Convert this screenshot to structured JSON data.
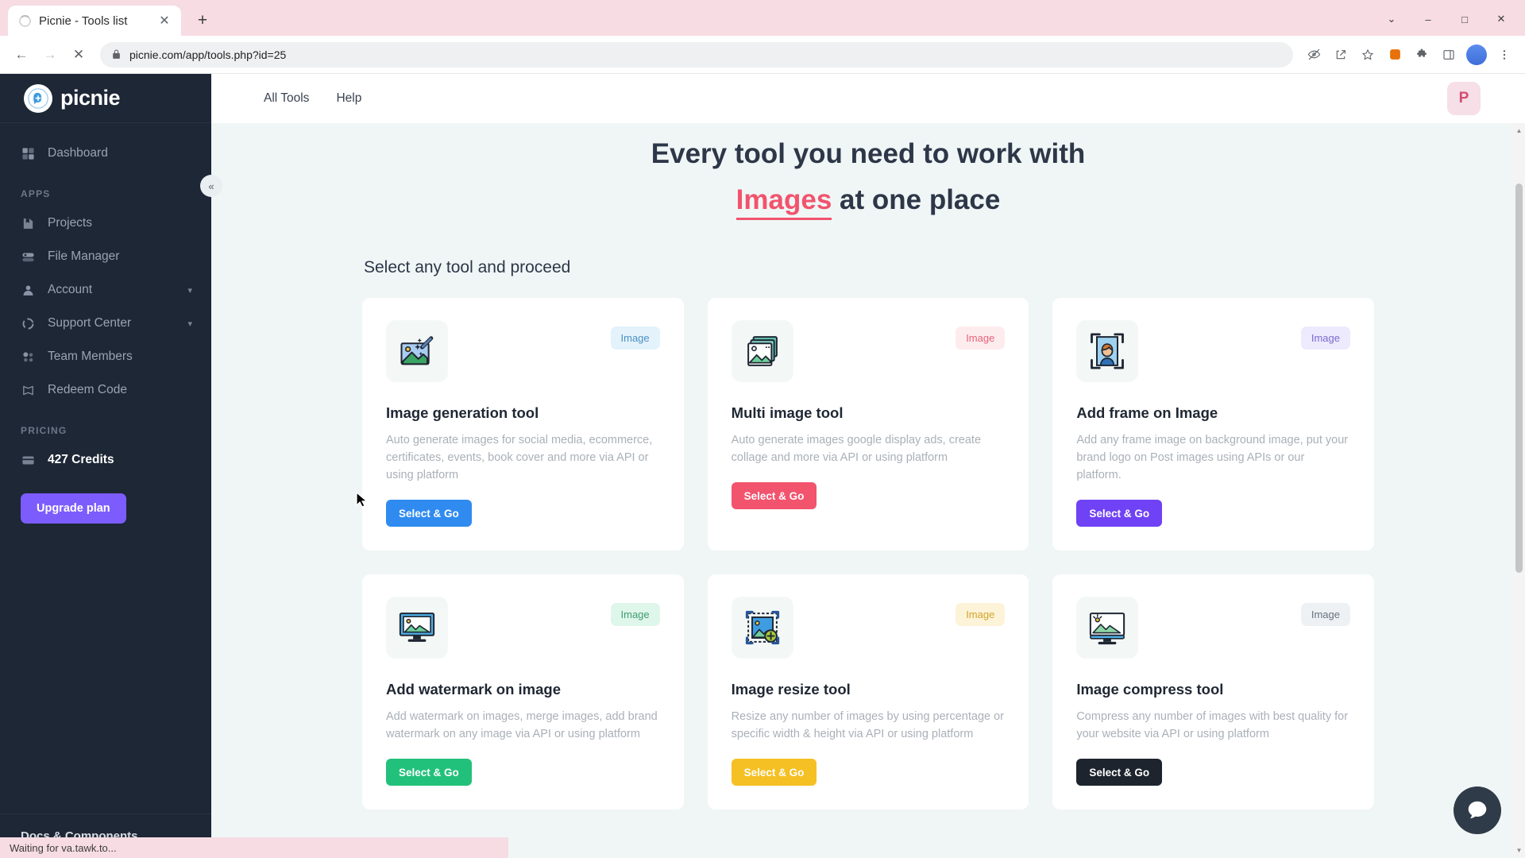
{
  "browser": {
    "tab": {
      "title": "Picnie - Tools list",
      "loading_icon": "spinner-icon",
      "close_icon": "close-icon"
    },
    "new_tab_label": "+",
    "window_controls": {
      "minimize": "–",
      "maximize": "□",
      "close": "✕",
      "list": "⌄"
    },
    "url": "picnie.com/app/tools.php?id=25",
    "nav": {
      "back": "←",
      "forward": "→",
      "stop": "✕"
    },
    "toolbar_icons": [
      "no-track-icon",
      "share-icon",
      "bookmark-star-icon",
      "extension-orange-icon",
      "puzzle-extension-icon",
      "sidepanel-icon",
      "profile-avatar",
      "menu-kebab-icon"
    ],
    "profile_initial": "",
    "status_text": "Waiting for va.tawk.to..."
  },
  "sidebar": {
    "brand": "picnie",
    "collapse_icon": "«",
    "items": [
      {
        "label": "Dashboard",
        "icon": "dashboard-grid-icon",
        "chevron": false
      },
      {
        "label": "Projects",
        "icon": "projects-box-icon",
        "chevron": false
      },
      {
        "label": "File Manager",
        "icon": "file-manager-icon",
        "chevron": false
      },
      {
        "label": "Account",
        "icon": "account-user-icon",
        "chevron": true
      },
      {
        "label": "Support Center",
        "icon": "support-life-ring-icon",
        "chevron": true
      },
      {
        "label": "Team Members",
        "icon": "team-members-icon",
        "chevron": false
      },
      {
        "label": "Redeem Code",
        "icon": "redeem-book-icon",
        "chevron": false
      }
    ],
    "section_apps": "APPS",
    "section_pricing": "PRICING",
    "credits": "427 Credits",
    "credits_icon": "credits-card-icon",
    "upgrade_label": "Upgrade plan",
    "footer_label": "Docs & Components"
  },
  "topbar": {
    "links": [
      {
        "label": "All Tools"
      },
      {
        "label": "Help"
      }
    ],
    "user_initial": "P"
  },
  "hero": {
    "line1": "Every tool you need to work with",
    "accent": "Images",
    "line2_tail": "at one place"
  },
  "main": {
    "section_title": "Select any tool and proceed",
    "cards": [
      {
        "title": "Image generation tool",
        "desc": "Auto generate images for social media, ecommerce, certificates, events, book cover and more via API or using platform",
        "badge": "Image",
        "badge_bg": "#e3f2fb",
        "badge_color": "#4b91c4",
        "btn_label": "Select & Go",
        "btn_bg": "#2f8bf0",
        "icon": "image-magic-wand-icon"
      },
      {
        "title": "Multi image tool",
        "desc": "Auto generate images google display ads, create collage and more via API or using platform",
        "badge": "Image",
        "badge_bg": "#fdecee",
        "badge_color": "#e8637a",
        "btn_label": "Select & Go",
        "btn_bg": "#f2536d",
        "icon": "multi-image-stack-icon"
      },
      {
        "title": "Add frame on Image",
        "desc": "Add any frame image on background image, put your brand logo on Post images using APIs or our platform.",
        "badge": "Image",
        "badge_bg": "#eeeafd",
        "badge_color": "#7a6bd0",
        "btn_label": "Select & Go",
        "btn_bg": "#7042f5",
        "icon": "frame-portrait-icon"
      },
      {
        "title": "Add watermark on image",
        "desc": "Add watermark on images, merge images, add brand watermark on any image via API or using platform",
        "badge": "Image",
        "badge_bg": "#dff6ea",
        "badge_color": "#3f9e70",
        "btn_label": "Select & Go",
        "btn_bg": "#22c17b",
        "icon": "watermark-monitor-icon"
      },
      {
        "title": "Image resize tool",
        "desc": "Resize any number of images by using percentage or specific width & height via API or using platform",
        "badge": "Image",
        "badge_bg": "#fdf3d8",
        "badge_color": "#d2a42c",
        "btn_label": "Select & Go",
        "btn_bg": "#f5c023",
        "icon": "image-resize-crop-icon"
      },
      {
        "title": "Image compress tool",
        "desc": "Compress any number of images with best quality for your website via API or using platform",
        "badge": "Image",
        "badge_bg": "#eef1f4",
        "badge_color": "#68727f",
        "btn_label": "Select & Go",
        "btn_bg": "#1d242e",
        "icon": "image-compress-monitor-icon"
      }
    ]
  },
  "widgets": {
    "chat_icon": "chat-bubble-icon"
  }
}
